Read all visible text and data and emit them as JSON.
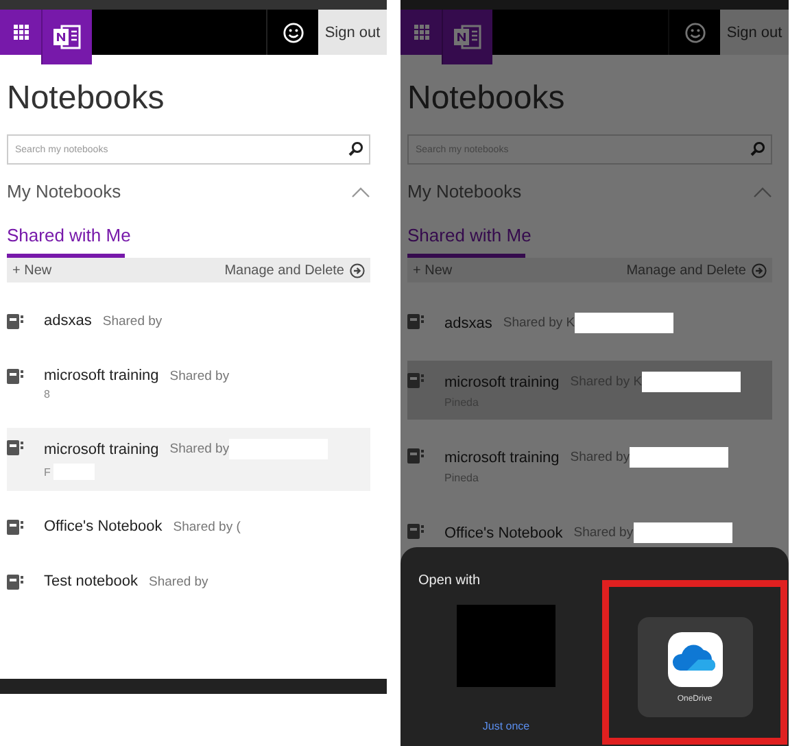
{
  "screens": [
    {
      "dimmed": false,
      "header": {
        "sign_out": "Sign out"
      },
      "title": "Notebooks",
      "search": {
        "placeholder": "Search my notebooks"
      },
      "section": "My Notebooks",
      "tab": {
        "label": "Shared with Me",
        "selected": true
      },
      "toolbar": {
        "new": "+ New",
        "manage": "Manage and Delete"
      },
      "notebooks": [
        {
          "name": "adsxas",
          "shared_by": "Shared by",
          "selected": false
        },
        {
          "name": "microsoft training",
          "shared_by": "Shared by",
          "sub": "8",
          "selected": false
        },
        {
          "name": "microsoft training",
          "shared_by": "Shared by",
          "shared_by_redacted": true,
          "sub": "F",
          "sub_redacted": true,
          "selected": true
        },
        {
          "name": "Office's Notebook",
          "shared_by": "Shared by (",
          "selected": false
        },
        {
          "name": "Test notebook",
          "shared_by": "Shared by",
          "selected": false
        }
      ],
      "bottom_bar": true
    },
    {
      "dimmed": true,
      "header": {
        "sign_out": "Sign out"
      },
      "title": "Notebooks",
      "search": {
        "placeholder": "Search my notebooks"
      },
      "section": "My Notebooks",
      "tab": {
        "label": "Shared with Me",
        "selected": true
      },
      "toolbar": {
        "new": "+ New",
        "manage": "Manage and Delete"
      },
      "notebooks": [
        {
          "name": "adsxas",
          "shared_by": "Shared by K",
          "shared_by_redacted": true,
          "selected": false
        },
        {
          "name": "microsoft training",
          "shared_by": "Shared by K",
          "shared_by_redacted": true,
          "sub": "Pineda",
          "selected": true
        },
        {
          "name": "microsoft training",
          "shared_by": "Shared by",
          "shared_by_redacted": true,
          "sub": "Pineda",
          "selected": false
        },
        {
          "name": "Office's Notebook",
          "shared_by": "Shared by",
          "shared_by_redacted": true,
          "selected": false
        }
      ],
      "sheet": {
        "title": "Open with",
        "apps": [
          {
            "kind": "redacted"
          },
          {
            "kind": "onedrive",
            "label": "OneDrive",
            "highlighted": true
          }
        ],
        "button": "Just once"
      }
    }
  ]
}
